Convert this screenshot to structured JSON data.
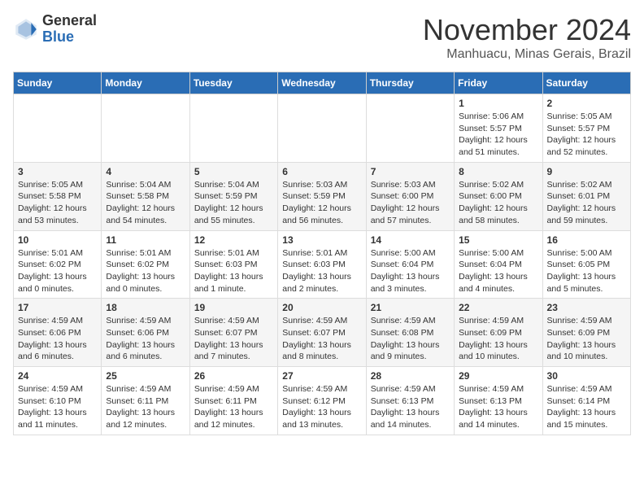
{
  "logo": {
    "general": "General",
    "blue": "Blue"
  },
  "title": "November 2024",
  "location": "Manhuacu, Minas Gerais, Brazil",
  "days_of_week": [
    "Sunday",
    "Monday",
    "Tuesday",
    "Wednesday",
    "Thursday",
    "Friday",
    "Saturday"
  ],
  "weeks": [
    [
      {
        "day": "",
        "info": ""
      },
      {
        "day": "",
        "info": ""
      },
      {
        "day": "",
        "info": ""
      },
      {
        "day": "",
        "info": ""
      },
      {
        "day": "",
        "info": ""
      },
      {
        "day": "1",
        "info": "Sunrise: 5:06 AM\nSunset: 5:57 PM\nDaylight: 12 hours and 51 minutes."
      },
      {
        "day": "2",
        "info": "Sunrise: 5:05 AM\nSunset: 5:57 PM\nDaylight: 12 hours and 52 minutes."
      }
    ],
    [
      {
        "day": "3",
        "info": "Sunrise: 5:05 AM\nSunset: 5:58 PM\nDaylight: 12 hours and 53 minutes."
      },
      {
        "day": "4",
        "info": "Sunrise: 5:04 AM\nSunset: 5:58 PM\nDaylight: 12 hours and 54 minutes."
      },
      {
        "day": "5",
        "info": "Sunrise: 5:04 AM\nSunset: 5:59 PM\nDaylight: 12 hours and 55 minutes."
      },
      {
        "day": "6",
        "info": "Sunrise: 5:03 AM\nSunset: 5:59 PM\nDaylight: 12 hours and 56 minutes."
      },
      {
        "day": "7",
        "info": "Sunrise: 5:03 AM\nSunset: 6:00 PM\nDaylight: 12 hours and 57 minutes."
      },
      {
        "day": "8",
        "info": "Sunrise: 5:02 AM\nSunset: 6:00 PM\nDaylight: 12 hours and 58 minutes."
      },
      {
        "day": "9",
        "info": "Sunrise: 5:02 AM\nSunset: 6:01 PM\nDaylight: 12 hours and 59 minutes."
      }
    ],
    [
      {
        "day": "10",
        "info": "Sunrise: 5:01 AM\nSunset: 6:02 PM\nDaylight: 13 hours and 0 minutes."
      },
      {
        "day": "11",
        "info": "Sunrise: 5:01 AM\nSunset: 6:02 PM\nDaylight: 13 hours and 0 minutes."
      },
      {
        "day": "12",
        "info": "Sunrise: 5:01 AM\nSunset: 6:03 PM\nDaylight: 13 hours and 1 minute."
      },
      {
        "day": "13",
        "info": "Sunrise: 5:01 AM\nSunset: 6:03 PM\nDaylight: 13 hours and 2 minutes."
      },
      {
        "day": "14",
        "info": "Sunrise: 5:00 AM\nSunset: 6:04 PM\nDaylight: 13 hours and 3 minutes."
      },
      {
        "day": "15",
        "info": "Sunrise: 5:00 AM\nSunset: 6:04 PM\nDaylight: 13 hours and 4 minutes."
      },
      {
        "day": "16",
        "info": "Sunrise: 5:00 AM\nSunset: 6:05 PM\nDaylight: 13 hours and 5 minutes."
      }
    ],
    [
      {
        "day": "17",
        "info": "Sunrise: 4:59 AM\nSunset: 6:06 PM\nDaylight: 13 hours and 6 minutes."
      },
      {
        "day": "18",
        "info": "Sunrise: 4:59 AM\nSunset: 6:06 PM\nDaylight: 13 hours and 6 minutes."
      },
      {
        "day": "19",
        "info": "Sunrise: 4:59 AM\nSunset: 6:07 PM\nDaylight: 13 hours and 7 minutes."
      },
      {
        "day": "20",
        "info": "Sunrise: 4:59 AM\nSunset: 6:07 PM\nDaylight: 13 hours and 8 minutes."
      },
      {
        "day": "21",
        "info": "Sunrise: 4:59 AM\nSunset: 6:08 PM\nDaylight: 13 hours and 9 minutes."
      },
      {
        "day": "22",
        "info": "Sunrise: 4:59 AM\nSunset: 6:09 PM\nDaylight: 13 hours and 10 minutes."
      },
      {
        "day": "23",
        "info": "Sunrise: 4:59 AM\nSunset: 6:09 PM\nDaylight: 13 hours and 10 minutes."
      }
    ],
    [
      {
        "day": "24",
        "info": "Sunrise: 4:59 AM\nSunset: 6:10 PM\nDaylight: 13 hours and 11 minutes."
      },
      {
        "day": "25",
        "info": "Sunrise: 4:59 AM\nSunset: 6:11 PM\nDaylight: 13 hours and 12 minutes."
      },
      {
        "day": "26",
        "info": "Sunrise: 4:59 AM\nSunset: 6:11 PM\nDaylight: 13 hours and 12 minutes."
      },
      {
        "day": "27",
        "info": "Sunrise: 4:59 AM\nSunset: 6:12 PM\nDaylight: 13 hours and 13 minutes."
      },
      {
        "day": "28",
        "info": "Sunrise: 4:59 AM\nSunset: 6:13 PM\nDaylight: 13 hours and 14 minutes."
      },
      {
        "day": "29",
        "info": "Sunrise: 4:59 AM\nSunset: 6:13 PM\nDaylight: 13 hours and 14 minutes."
      },
      {
        "day": "30",
        "info": "Sunrise: 4:59 AM\nSunset: 6:14 PM\nDaylight: 13 hours and 15 minutes."
      }
    ]
  ]
}
